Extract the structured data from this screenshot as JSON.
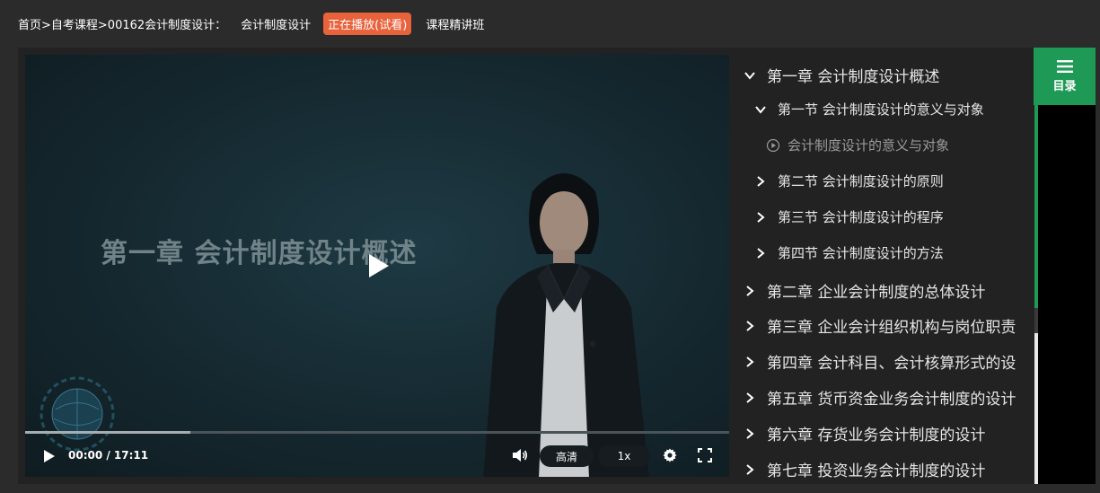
{
  "breadcrumb": {
    "home": "首页>自考课程>",
    "course_code": "00162会计制度设计：",
    "course_name": "会计制度设计",
    "badge": "正在播放(试看)",
    "class_name": "课程精讲班"
  },
  "video": {
    "slide_title": "第一章  会计制度设计概述",
    "time": "00:00 / 17:11",
    "progress_buffered": 0.235,
    "quality_label": "高清",
    "speed_label": "1x"
  },
  "catalog": {
    "tab_label": "目录",
    "items": [
      {
        "level": "chapter",
        "expanded": true,
        "label": "第一章 会计制度设计概述"
      },
      {
        "level": "section",
        "expanded": true,
        "label": "第一节 会计制度设计的意义与对象"
      },
      {
        "level": "lesson",
        "label": "会计制度设计的意义与对象"
      },
      {
        "level": "section",
        "expanded": false,
        "label": "第二节 会计制度设计的原则"
      },
      {
        "level": "section",
        "expanded": false,
        "label": "第三节 会计制度设计的程序"
      },
      {
        "level": "section",
        "expanded": false,
        "label": "第四节 会计制度设计的方法"
      },
      {
        "level": "chapter",
        "expanded": false,
        "label": "第二章 企业会计制度的总体设计"
      },
      {
        "level": "chapter",
        "expanded": false,
        "label": "第三章 企业会计组织机构与岗位职责"
      },
      {
        "level": "chapter",
        "expanded": false,
        "label": "第四章 会计科目、会计核算形式的设"
      },
      {
        "level": "chapter",
        "expanded": false,
        "label": "第五章 货币资金业务会计制度的设计"
      },
      {
        "level": "chapter",
        "expanded": false,
        "label": "第六章 存货业务会计制度的设计"
      },
      {
        "level": "chapter",
        "expanded": false,
        "label": "第七章 投资业务会计制度的设计"
      }
    ]
  },
  "colors": {
    "accent_green": "#1f9a56",
    "badge_orange": "#e8623c",
    "panel_bg": "#222222",
    "page_bg": "#2b2b2b"
  }
}
